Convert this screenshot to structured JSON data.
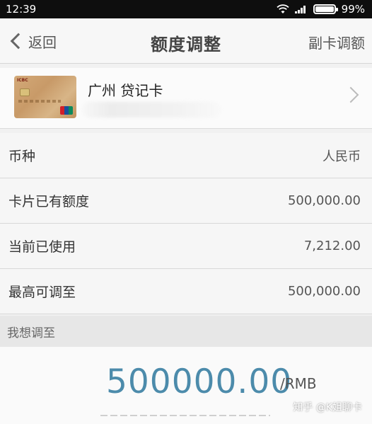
{
  "status_bar": {
    "time": "12:39",
    "battery": "99%"
  },
  "nav": {
    "back_label": "返回",
    "title": "额度调整",
    "right_action": "副卡调额"
  },
  "card": {
    "name": "广州 贷记卡",
    "bank_mark": "ICBC 中国工商银行"
  },
  "info_rows": [
    {
      "label": "币种",
      "value": "人民币"
    },
    {
      "label": "卡片已有额度",
      "value": "500,000.00"
    },
    {
      "label": "当前已使用",
      "value": "7,212.00"
    },
    {
      "label": "最高可调至",
      "value": "500,000.00"
    }
  ],
  "adjust": {
    "section_label": "我想调至",
    "amount": "500000.00",
    "unit": "/RMB"
  },
  "watermark": "知乎 @K姐聊卡",
  "colors": {
    "amount": "#4c8bab",
    "status_bar": "#0e0e0e"
  }
}
